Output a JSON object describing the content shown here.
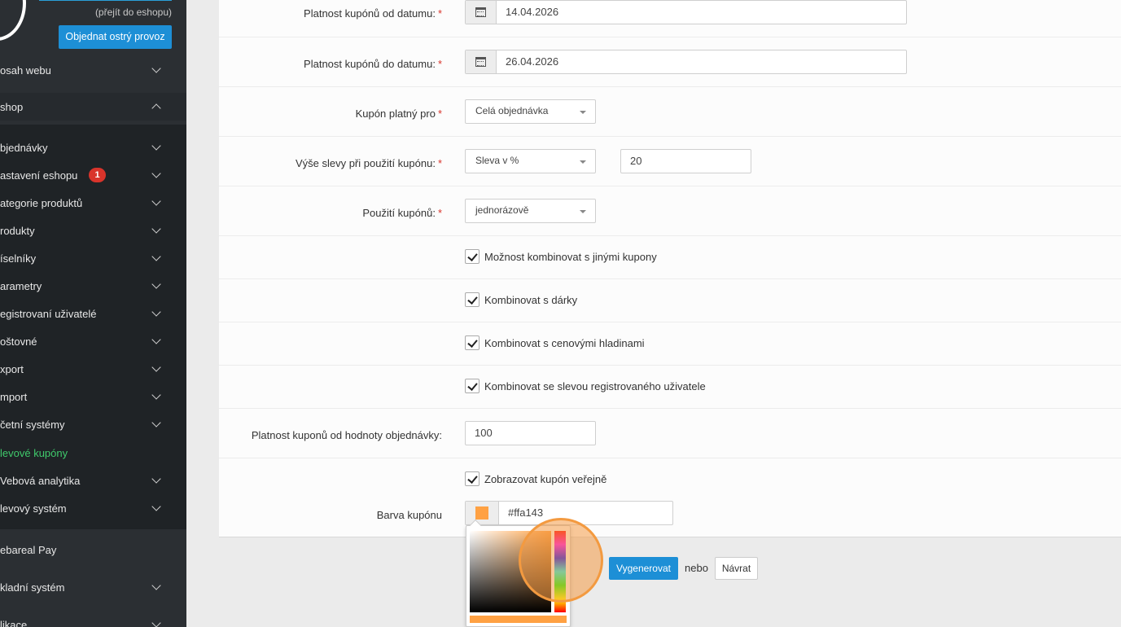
{
  "sidebar": {
    "eshop_link": "(přejít do eshopu)",
    "order_button": "Objednat ostrý provoz",
    "items": [
      {
        "label": "osah webu"
      },
      {
        "label": "shop"
      },
      {
        "label": "bjednávky"
      },
      {
        "label": "astavení eshopu",
        "badge": "1"
      },
      {
        "label": "ategorie produktů"
      },
      {
        "label": "rodukty"
      },
      {
        "label": "íselníky"
      },
      {
        "label": "arametry"
      },
      {
        "label": "egistrovaní uživatelé"
      },
      {
        "label": "oštovné"
      },
      {
        "label": "xport"
      },
      {
        "label": "mport"
      },
      {
        "label": "četní systémy"
      },
      {
        "label": "levové kupóny"
      },
      {
        "label": "Vebová analytika"
      },
      {
        "label": "levový systém"
      },
      {
        "label": "ebareal Pay"
      },
      {
        "label": "kladní systém"
      },
      {
        "label": "likace"
      }
    ]
  },
  "form": {
    "valid_from": {
      "label": "Platnost kupónů od datumu:",
      "required": "*",
      "value": "14.04.2026"
    },
    "valid_to": {
      "label": "Platnost kupónů do datumu:",
      "required": "*",
      "value": "26.04.2026"
    },
    "valid_for": {
      "label": "Kupón platný pro",
      "required": "*",
      "value": "Celá objednávka"
    },
    "discount": {
      "label": "Výše slevy při použití kupónu:",
      "required": "*",
      "type": "Sleva v %",
      "value": "20"
    },
    "usage": {
      "label": "Použití kupónů:",
      "required": "*",
      "value": "jednorázově"
    },
    "checkboxes": [
      {
        "label": "Možnost kombinovat s jinými kupony",
        "checked": true
      },
      {
        "label": "Kombinovat s dárky",
        "checked": true
      },
      {
        "label": "Kombinovat s cenovými hladinami",
        "checked": true
      },
      {
        "label": "Kombinovat se slevou registrovaného uživatele",
        "checked": true
      }
    ],
    "min_order": {
      "label": "Platnost kuponů od hodnoty objednávky:",
      "value": "100"
    },
    "public": {
      "label": "Zobrazovat kupón veřejně",
      "checked": true
    },
    "color": {
      "label": "Barva kupónu",
      "value": "#ffa143"
    }
  },
  "actions": {
    "generate": "Vygenerovat",
    "or": "nebo",
    "back": "Návrat"
  },
  "colors": {
    "accent": "#1d8fd6",
    "coupon": "#ffa143",
    "sidebar_bg": "#2b2f33",
    "active_green": "#3fc96b",
    "badge_red": "#d9342b"
  }
}
